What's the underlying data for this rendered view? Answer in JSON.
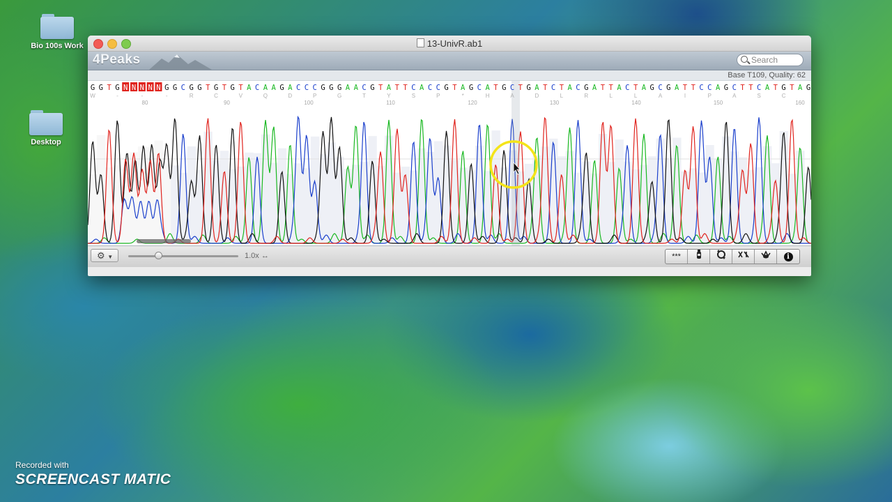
{
  "desktop": {
    "icons": [
      {
        "label": "Bio 100s Work"
      },
      {
        "label": "Desktop"
      }
    ]
  },
  "window": {
    "title": "13-UnivR.ab1",
    "app_name": "4Peaks",
    "search_placeholder": "Search",
    "base_info": "Base T109, Quality: 62",
    "sequence": "GGTGNNNNNGGCGGTGTGTACAAGACCCGGGAACGTATTCACCGTAGCATGCTGATCTACGATTACTAGCGATTCCAGCTTCATGTAG",
    "amino_acids": "W - - - R C V Q D P G T Y S P * H A D L R L L A I P A S C",
    "positions": [
      "80",
      "90",
      "100",
      "110",
      "120",
      "130",
      "140",
      "150",
      "160"
    ],
    "zoom_label": "1.0x",
    "tools": [
      "***",
      "",
      "",
      "",
      "",
      "i"
    ]
  },
  "colors": {
    "A": "#19b821",
    "C": "#1a3fcc",
    "G": "#111111",
    "T": "#e0231d",
    "N": "#e0231d"
  },
  "watermark": {
    "line1": "Recorded with",
    "line2": "SCREENCAST MATIC"
  }
}
